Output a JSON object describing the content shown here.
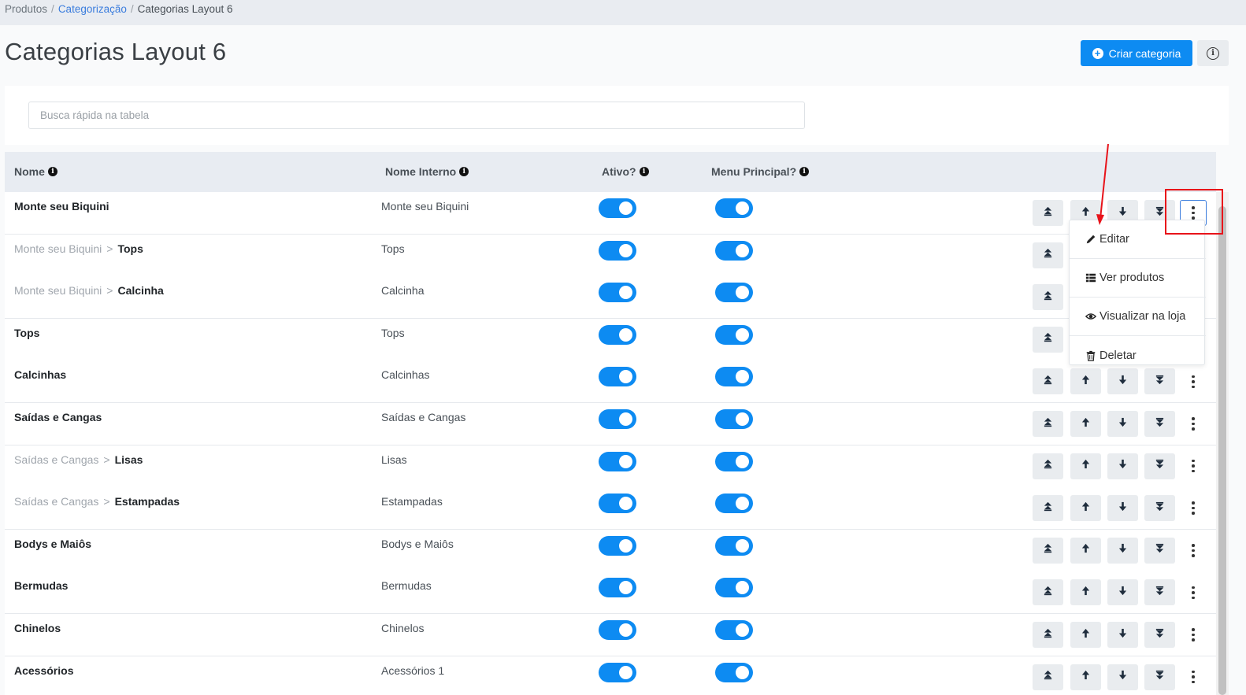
{
  "breadcrumb": {
    "items": [
      "Produtos",
      "Categorização",
      "Categorias Layout 6"
    ],
    "separator": "/"
  },
  "header": {
    "title": "Categorias Layout 6",
    "create_label": "Criar categoria"
  },
  "search": {
    "placeholder": "Busca rápida na tabela"
  },
  "table": {
    "columns": [
      "Nome",
      "Nome Interno",
      "Ativo?",
      "Menu Principal?"
    ],
    "rows": [
      {
        "parent": "",
        "name": "Monte seu Biquini",
        "internal": "Monte seu Biquini",
        "active": true,
        "main_menu": true
      },
      {
        "parent": "Monte seu Biquini",
        "name": "Tops",
        "internal": "Tops",
        "active": true,
        "main_menu": true
      },
      {
        "parent": "Monte seu Biquini",
        "name": "Calcinha",
        "internal": "Calcinha",
        "active": true,
        "main_menu": true
      },
      {
        "parent": "",
        "name": "Tops",
        "internal": "Tops",
        "active": true,
        "main_menu": true
      },
      {
        "parent": "",
        "name": "Calcinhas",
        "internal": "Calcinhas",
        "active": true,
        "main_menu": true
      },
      {
        "parent": "",
        "name": "Saídas e Cangas",
        "internal": "Saídas e Cangas",
        "active": true,
        "main_menu": true
      },
      {
        "parent": "Saídas e Cangas",
        "name": "Lisas",
        "internal": "Lisas",
        "active": true,
        "main_menu": true
      },
      {
        "parent": "Saídas e Cangas",
        "name": "Estampadas",
        "internal": "Estampadas",
        "active": true,
        "main_menu": true
      },
      {
        "parent": "",
        "name": "Bodys e Maiôs",
        "internal": "Bodys e Maiôs",
        "active": true,
        "main_menu": true
      },
      {
        "parent": "",
        "name": "Bermudas",
        "internal": "Bermudas",
        "active": true,
        "main_menu": true
      },
      {
        "parent": "",
        "name": "Chinelos",
        "internal": "Chinelos",
        "active": true,
        "main_menu": true
      },
      {
        "parent": "",
        "name": "Acessórios",
        "internal": "Acessórios 1",
        "active": true,
        "main_menu": true
      }
    ]
  },
  "dropdown": {
    "items": [
      "Editar",
      "Ver produtos",
      "Visualizar na loja",
      "Deletar"
    ]
  },
  "colors": {
    "accent": "#0d8bf2",
    "link": "#3b7ddd",
    "annotation": "#e8131a"
  },
  "icons": [
    "plus-circle-icon",
    "info-icon",
    "move-top-icon",
    "move-up-icon",
    "move-down-icon",
    "move-bottom-icon",
    "kebab-icon",
    "pencil-icon",
    "grid-icon",
    "eye-icon",
    "trash-icon"
  ]
}
